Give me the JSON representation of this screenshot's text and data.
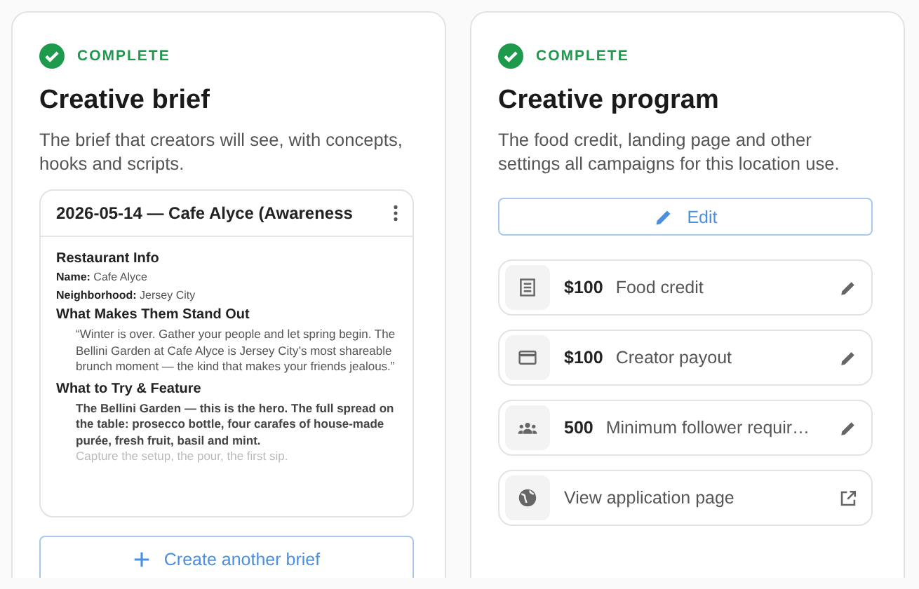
{
  "brief_card": {
    "status": {
      "label": "COMPLETE",
      "done": true
    },
    "title": "Creative brief",
    "description": "The brief that creators will see, with concepts, hooks and scripts.",
    "preview": {
      "title": "2026-05-14 — Cafe Alyce (Awareness",
      "sections": [
        {
          "heading": "Restaurant Info",
          "kind": "fields",
          "fields": [
            {
              "label": "Name:",
              "value": "Cafe Alyce"
            },
            {
              "label": "Neighborhood:",
              "value": "Jersey City"
            }
          ]
        },
        {
          "heading": "What Makes Them Stand Out",
          "kind": "quote",
          "paragraphs": [
            {
              "text": "“Winter is over. Gather your people and let spring begin. The Bellini Garden at Cafe Alyce is Jersey City’s most shareable brunch moment — the kind that makes your friends jealous.”",
              "faded": false
            }
          ]
        },
        {
          "heading": "What to Try & Feature",
          "kind": "body",
          "paragraphs": [
            {
              "text": "The Bellini Garden — this is the hero. The full spread on the table: prosecco bottle, four carafes of house-made purée, fresh fruit, basil and mint.",
              "faded": false
            },
            {
              "text": "Capture the setup, the pour, the first sip.",
              "faded": true
            }
          ]
        }
      ]
    },
    "button": "Create another brief"
  },
  "program_card": {
    "status": {
      "label": "COMPLETE",
      "done": true
    },
    "title": "Creative program",
    "description": "The food credit, landing page and other settings all campaigns for this location use.",
    "edit_button": "Edit",
    "items": [
      {
        "kind": "setting",
        "value": "$100",
        "label": "Food credit"
      },
      {
        "kind": "setting",
        "value": "$100",
        "label": "Creator payout"
      },
      {
        "kind": "setting",
        "value": "500",
        "label": "Minimum follower requir…"
      },
      {
        "kind": "link",
        "label": "View application page"
      }
    ]
  }
}
